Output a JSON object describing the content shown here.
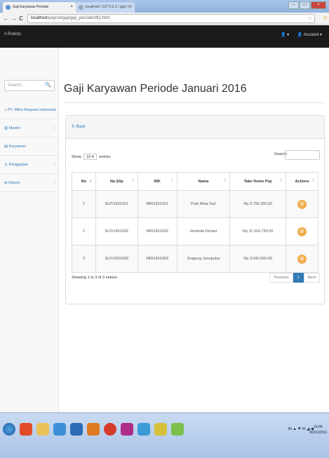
{
  "browser": {
    "tabs": [
      {
        "label": "Gaji Karyawan Periode",
        "close": "×"
      },
      {
        "label": "localhost / 127.0.0.1 / gaji / t...",
        "close": "×"
      }
    ],
    "window_buttons": [
      "–",
      "□",
      "×"
    ],
    "address": {
      "host": "localhost",
      "path": "/payroll/gaji/gaji_periode/MQ.html"
    },
    "back": "←",
    "forward": "→",
    "reload": "C",
    "star": "☆",
    "menu": "≡"
  },
  "navbar": {
    "brand": "# Robots",
    "user_icon": "👤 ▾",
    "account": "👤 Account ▾"
  },
  "sidebar": {
    "search_placeholder": "Search...",
    "search_icon": "🔍",
    "items": [
      {
        "label": "⌂ PT. Mitra Request Indonesia",
        "arrow": ""
      },
      {
        "label": "▥ Master",
        "arrow": "‹"
      },
      {
        "label": "▤ Karyawan",
        "arrow": ""
      },
      {
        "label": "♙ Penggajian",
        "arrow": "‹"
      },
      {
        "label": "⊕ Report",
        "arrow": "‹"
      }
    ]
  },
  "main": {
    "title": "Gaji Karyawan Periode Januari 2016",
    "back_link": "↻ Back",
    "show_label": "Show",
    "show_value": "10",
    "entries_label": "entries",
    "search_label": "Search:",
    "columns": [
      "No",
      "No.Slip",
      "NIK",
      "Nama",
      "Take Home Pay",
      "Actions"
    ],
    "rows": [
      {
        "no": "1",
        "slip": "SLP/1601001",
        "nik": "MRI1601001",
        "nama": "Putri Alisa Sari",
        "thp": "Rp 3.756.250,00"
      },
      {
        "no": "2",
        "slip": "SLP/1601002",
        "nik": "MRI1601002",
        "nama": "Herlinda Fitriani",
        "thp": "Rp 11.016.750,00"
      },
      {
        "no": "3",
        "slip": "SLP/1601003",
        "nik": "MRI1601003",
        "nama": "Sragung Januputra",
        "thp": "Rp 3.040.000,00"
      }
    ],
    "action_icon": "⚙",
    "showing": "Showing 1 to 3 of 3 entries",
    "pager": {
      "prev": "Previous",
      "page": "1",
      "next": "Next"
    }
  },
  "taskbar": {
    "tray": "IN  ▲ ⚑ ✉ ◢ ◀",
    "time": "16:05",
    "date": "06/01/2016"
  },
  "colors": {
    "brand_blue": "#337ab7",
    "navbar": "#1a1a1a",
    "action": "#f0ad4e"
  }
}
